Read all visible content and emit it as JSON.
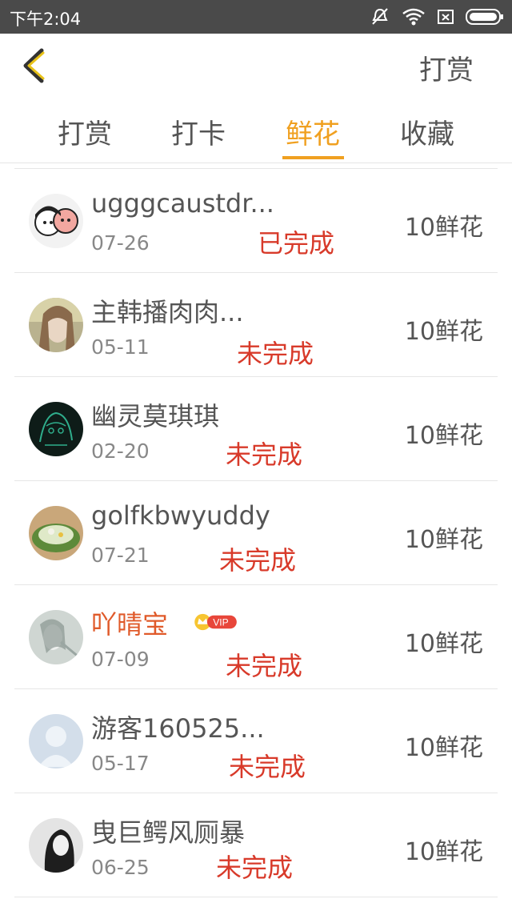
{
  "status_bar": {
    "time": "下午2:04",
    "icons": [
      "mute-icon",
      "wifi-icon",
      "sim-icon",
      "battery-icon"
    ]
  },
  "header": {
    "back_icon": "chevron-left-icon",
    "action_label": "打赏"
  },
  "tabs": [
    {
      "label": "打赏",
      "active": false
    },
    {
      "label": "打卡",
      "active": false
    },
    {
      "label": "鲜花",
      "active": true
    },
    {
      "label": "收藏",
      "active": false
    }
  ],
  "colors": {
    "accent": "#f0a020",
    "status": "#d83a2a",
    "vip_name": "#e05a2a",
    "status_bar": "#4a4a4a"
  },
  "items": [
    {
      "name": "ugggcaustdr...",
      "date": "07-26",
      "status": "已完成",
      "amount": "10鲜花",
      "vip": false
    },
    {
      "name": "主韩播肉肉...",
      "date": "05-11",
      "status": "未完成",
      "amount": "10鲜花",
      "vip": false
    },
    {
      "name": "幽灵莫琪琪",
      "date": "02-20",
      "status": "未完成",
      "amount": "10鲜花",
      "vip": false
    },
    {
      "name": "golfkbwyuddy",
      "date": "07-21",
      "status": "未完成",
      "amount": "10鲜花",
      "vip": false
    },
    {
      "name": "吖晴宝",
      "date": "07-09",
      "status": "未完成",
      "amount": "10鲜花",
      "vip": true,
      "badge": "VIP"
    },
    {
      "name": "游客160525...",
      "date": "05-17",
      "status": "未完成",
      "amount": "10鲜花",
      "vip": false
    },
    {
      "name": "曳巨鳄风厕暴",
      "date": "06-25",
      "status": "未完成",
      "amount": "10鲜花",
      "vip": false
    }
  ]
}
